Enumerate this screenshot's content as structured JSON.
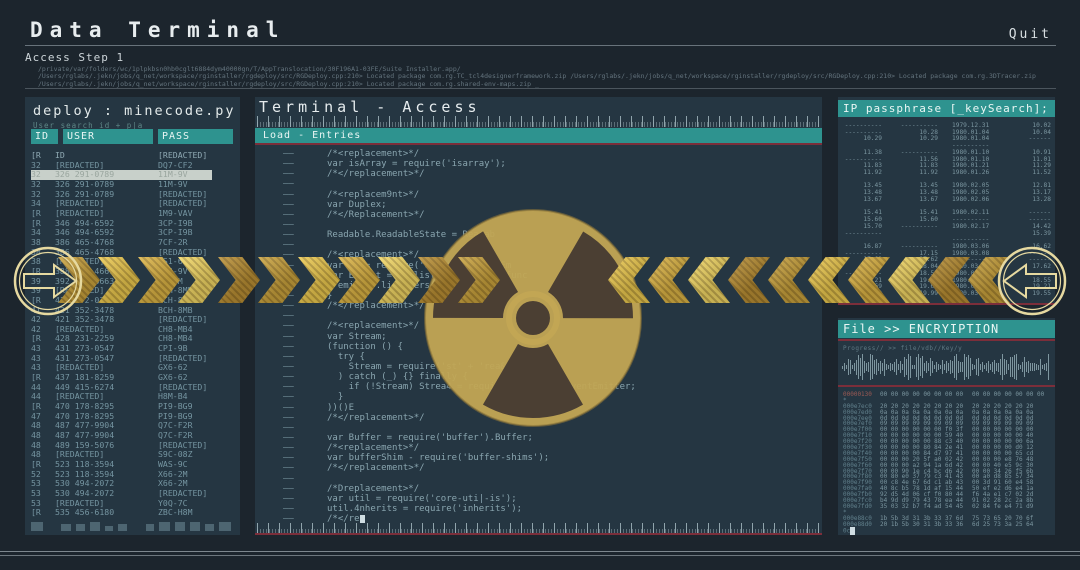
{
  "header": {
    "title": "Data Terminal",
    "step": "Access Step 1",
    "quit_label": "Quit",
    "log_lines": "/private/var/folders/wc/1plpkbsn0hb0cglt6884dym40000gn/T/AppTranslocation/30F196A1-03FE/Suite Installer.app/\n/Users/rglabs/.jekn/jobs/q_net/workspace/rginstaller/rgdeploy/src/RGDeploy.cpp:210> Located package com.rg.TC_tcl4designerframework.zip /Users/rglabs/.jekn/jobs/q_net/workspace/rginstaller/rgdeploy/src/RGDeploy.cpp:210> Located package com.rg.3DTracer.zip\n/Users/rglabs/.jekn/jobs/q_net/workspace/rginstaller/rgdeploy/src/RGDeploy.cpp:210> Located package com.rg.shared-env-maps.zip _"
  },
  "left_panel": {
    "title": "deploy : minecode.py",
    "subtitle": "User search id + p|a",
    "columns": {
      "id": "ID",
      "user": "USER",
      "pass": "PASS"
    },
    "highlight_row_index": 2,
    "rows": [
      [
        "[R",
        "ID",
        "[REDACTED]"
      ],
      [
        "32",
        "[REDACTED]",
        "DQ7-CF2"
      ],
      [
        "32",
        "326 291-0789",
        "11M-9V"
      ],
      [
        "32",
        "326 291-0789",
        "11M-9V"
      ],
      [
        "32",
        "326 291-0789",
        "[REDACTED]"
      ],
      [
        "34",
        "[REDACTED]",
        "[REDACTED]"
      ],
      [
        "[R",
        "[REDACTED]",
        "1M9-VAV"
      ],
      [
        "[R",
        "346 494-6592",
        "3CP-I9B"
      ],
      [
        "34",
        "346 494-6592",
        "3CP-I9B"
      ],
      [
        "38",
        "386 465-4768",
        "7CF-2R"
      ],
      [
        "38",
        "386 465-4768",
        "[REDACTED]"
      ],
      [
        "38",
        "[REDACTED]",
        "9S1-69"
      ],
      [
        "[R",
        "388 237-4661",
        "B1J-9V"
      ],
      [
        "39",
        "392 255-8663",
        "9Z-2M"
      ],
      [
        "39",
        "[REDACTED]",
        "BCH-8MB"
      ],
      [
        "[R",
        "411 172-0303",
        "BCH-8MB"
      ],
      [
        "41",
        "421 352-3478",
        "BCH-8MB"
      ],
      [
        "42",
        "421 352-3478",
        "[REDACTED]"
      ],
      [
        "42",
        "[REDACTED]",
        "CH8-MB4"
      ],
      [
        "[R",
        "428 231-2259",
        "CH8-MB4"
      ],
      [
        "43",
        "431 273-0547",
        "CPI-9B"
      ],
      [
        "43",
        "431 273-0547",
        "[REDACTED]"
      ],
      [
        "43",
        "[REDACTED]",
        "GX6-62"
      ],
      [
        "[R",
        "437 181-8259",
        "GX6-62"
      ],
      [
        "44",
        "449 415-6274",
        "[REDACTED]"
      ],
      [
        "44",
        "[REDACTED]",
        "H8M-B4"
      ],
      [
        "[R",
        "470 178-8295",
        "PI9-BG9"
      ],
      [
        "47",
        "470 178-8295",
        "PI9-BG9"
      ],
      [
        "48",
        "487 477-9904",
        "Q7C-F2R"
      ],
      [
        "48",
        "487 477-9904",
        "Q7C-F2R"
      ],
      [
        "48",
        "489 159-5076",
        "[REDACTED]"
      ],
      [
        "48",
        "[REDACTED]",
        "S9C-08Z"
      ],
      [
        "[R",
        "523 118-3594",
        "WAS-9C"
      ],
      [
        "52",
        "523 118-3594",
        "X66-2M"
      ],
      [
        "53",
        "530 494-2072",
        "X66-2M"
      ],
      [
        "53",
        "530 494-2072",
        "[REDACTED]"
      ],
      [
        "53",
        "[REDACTED]",
        "Y0Q-7C"
      ],
      [
        "[R",
        "535 456-6180",
        "ZBC-H8M"
      ]
    ]
  },
  "center_panel": {
    "title": "Terminal - Access",
    "bar_label": "Load - Entries",
    "code_lines": [
      "/*<replacement>*/",
      "var isArray = require('isarray');",
      "/*</replacement>*/",
      "",
      "/*<replacem9nt>*/",
      "var Duplex;",
      "/*</Replacement>*/",
      "",
      "Readable.ReadableState = Readab",
      "",
      "/*<replacement>*/",
      "var EE = require('ev3nts').EventEm",
      "var EEList = EE.listenerCount || func",
      "  emitter.listeners(type).length",
      "}",
      "/*</replacement>*/",
      "",
      "/*<replacement>*/",
      "var Stream;",
      "(function () {",
      "  try {",
      "    Stream = require('st' + 'rea&');",
      "  ) catch (_) {} finally {",
      "    if (!Stream) Strea4 = require('ev%nts').EventEmitter;",
      "  }",
      "))()E",
      "/*</replacement>*/",
      "",
      "var Buffer = require('buffer').Buffer;",
      "/*<replacement>*/",
      "var bufferShim - require('buffer-shims');",
      "/*</replacement>*/",
      "",
      "/*Dreplacement>*/",
      "var util = require('core-uti|-is');",
      "util.4nherits = require('inherits');",
      "/*</re"
    ]
  },
  "ip_panel": {
    "title": "IP passphrase [_keySearch];",
    "rows": [
      [
        "----------",
        "----------",
        "1979.12.31",
        "10.02"
      ],
      [
        "----------",
        "10.28",
        "1980.01.04",
        "10.04"
      ],
      [
        "10.29",
        "10.29",
        "1980.01.04",
        "------"
      ],
      [
        "",
        "",
        "----------",
        ""
      ],
      [
        "11.38",
        "----------",
        "1980.01.10",
        "10.91"
      ],
      [
        "----------",
        "11.56",
        "1980.01.10",
        "11.01"
      ],
      [
        "11.83",
        "11.83",
        "1980.01.21",
        "11.29"
      ],
      [
        "11.92",
        "11.92",
        "1980.01.26",
        "11.52"
      ],
      [
        "",
        "",
        "",
        ""
      ],
      [
        "13.45",
        "13.45",
        "1980.02.05",
        "12.81"
      ],
      [
        "13.48",
        "13.48",
        "1980.02.05",
        "13.17"
      ],
      [
        "13.67",
        "13.67",
        "1980.02.06",
        "13.28"
      ],
      [
        "",
        "",
        "",
        ""
      ],
      [
        "15.41",
        "15.41",
        "1980.02.11",
        "------"
      ],
      [
        "15.60",
        "15.60",
        "----------",
        "------"
      ],
      [
        "15.70",
        "----------",
        "1980.02.17",
        "14.42"
      ],
      [
        "----------",
        "",
        "",
        "15.39"
      ],
      [
        "",
        "",
        "----------",
        ""
      ],
      [
        "16.87",
        "----------",
        "1980.03.06",
        "16.62"
      ],
      [
        "----------",
        "17.15",
        "1980.03.08",
        "------"
      ],
      [
        "17.62",
        "17.62",
        "----------",
        "------"
      ],
      [
        "18.04",
        "18.04",
        "1980.03.17",
        "17.62"
      ],
      [
        "----------",
        "18.55",
        "1980.03.17",
        "------"
      ],
      [
        "19.21",
        "19.21",
        "1980.03.21",
        "18.55"
      ],
      [
        "19.69",
        "19.69",
        "1980.03.21",
        "19.21"
      ],
      [
        "19.99",
        "19.99",
        "1980.03.22",
        "19.55"
      ]
    ]
  },
  "encryption_panel": {
    "title": "File >> ENCRYIPTION",
    "progress_label": "Progress// >>  file/vdb//Key/y",
    "hex_rows": [
      [
        "00000130",
        "00 00 00 00 00 00 00 00",
        "00 00 00 00 00 00 00"
      ],
      [
        "*",
        "",
        ""
      ],
      [
        "000e7ec0",
        "20 20 20 20 20 20 20 20",
        "20 20 20 20 20 20"
      ],
      [
        "000e7ed0",
        "0a 0a 0a 0a 0a 0a 0a 0a",
        "0a 0a 0a 0a 0a 0a"
      ],
      [
        "000e7ee0",
        "0d 0d 0d 0d 0d 0d 0d 0d",
        "0d 0d 0d 0d 0d 0d"
      ],
      [
        "000e7ef0",
        "09 09 09 09 09 09 09 09",
        "09 09 09 09 09 09"
      ],
      [
        "000e7f00",
        "00 00 00 00 00 00 f0 3f",
        "00 00 00 00 00 00"
      ],
      [
        "000e7f10",
        "00 00 00 00 00 00 59 40",
        "00 00 00 00 00 40"
      ],
      [
        "000e7f20",
        "00 00 00 00 00 88 c3 40",
        "00 00 00 00 00 6a"
      ],
      [
        "000e7f30",
        "00 00 00 00 80 84 2e 41",
        "00 00 00 00 d0 12"
      ],
      [
        "000e7f40",
        "00 00 00 00 84 d7 97 41",
        "00 00 00 00 65 cd"
      ],
      [
        "000e7f50",
        "00 00 00 20 5f a0 02 42",
        "00 00 00 e8 76 48"
      ],
      [
        "000e7f60",
        "00 00 00 a2 94 1a 6d 42",
        "00 00 40 e5 9c 30"
      ],
      [
        "000e7f70",
        "00 00 90 1e c4 bc d6 42",
        "00 00 34 26 f5 6b"
      ],
      [
        "000e7f80",
        "00 80 e0 37 79 c3 41 43",
        "00 a0 d8 85 57 34"
      ],
      [
        "000e7f90",
        "00 c8 4e 67 6d c1 ab 43",
        "00 3d 91 60 e4 58"
      ],
      [
        "000e7fa0",
        "40 8c b5 78 1d af 15 44",
        "50 ef e2 d6 e4 1a"
      ],
      [
        "000e7fb0",
        "92 d5 4d 06 cf f0 80 44",
        "f6 4a e1 c7 02 2d"
      ],
      [
        "000e7fc0",
        "b4 9d d9 79 43 78 ea 44",
        "91 02 28 2c 2a 8b"
      ],
      [
        "000e7fd0",
        "35 03 32 b7 f4 ad 54 45",
        "02 84 fe e4 71 d9"
      ],
      [
        "*",
        "",
        ""
      ],
      [
        "000e88c0",
        "1b 5b 3d 31 3b 33 37 6d",
        "75 73 65 20 70 6f"
      ],
      [
        "000e88d0",
        "20 1b 5b 30 31 3b 33 36",
        "6d 25 73 3a 25 64"
      ],
      [
        "0c",
        "",
        ""
      ]
    ]
  },
  "icons": {
    "left_nav": "arrow-right-circle-icon",
    "right_nav": "arrow-left-circle-icon",
    "center": "radiation-icon"
  },
  "colors": {
    "accent_teal": "#2e938f",
    "alert_red": "#7c2e3a",
    "arrow_shades": [
      "#c9a23d",
      "#ecc94f",
      "#dcb445",
      "#f2d765",
      "#b98f34"
    ],
    "radiation_disc": "#c2a654",
    "radiation_blades": "#4b3f33",
    "circle_arrow_stroke": "#e6d9a0"
  }
}
